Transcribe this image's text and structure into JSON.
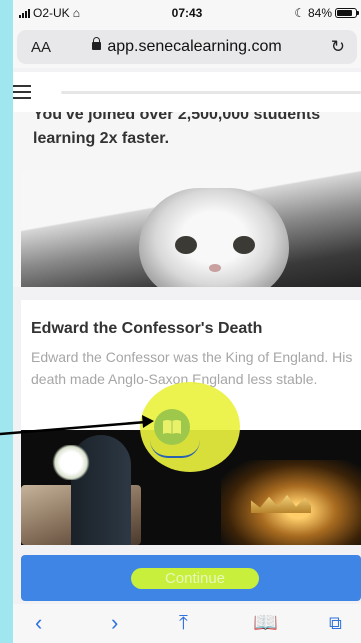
{
  "status_bar": {
    "carrier": "O2-UK",
    "time": "07:43",
    "battery_percent": "84%",
    "battery_level": 0.84,
    "signal_icon": "signal-bars-icon",
    "wifi_icon": "wifi-icon"
  },
  "browser": {
    "text_size_label": "AA",
    "url": "app.senecalearning.com",
    "lock_icon": "lock-icon",
    "reload_icon": "reload-icon"
  },
  "header": {
    "menu_icon": "hamburger-menu-icon"
  },
  "card_intro": {
    "cut_text": "You've joined over 2,500,000 students",
    "line2": "learning 2x faster.",
    "image": "cat-photo"
  },
  "card_lesson": {
    "title": "Edward the Confessor's Death",
    "description": "Edward the Confessor was the King of England. His death made Anglo-Saxon England less stable.",
    "image": "funeral-coffin-crown-photo",
    "book_icon": "open-book-icon"
  },
  "footer": {
    "continue_label": "Continue"
  },
  "toolbar": {
    "back_icon": "back-chevron-icon",
    "forward_icon": "forward-chevron-icon",
    "share_icon": "share-icon",
    "bookmarks_icon": "bookmarks-icon",
    "tabs_icon": "tabs-icon"
  },
  "colors": {
    "background": "#9fe6ee",
    "accent": "#3f85e6",
    "continue_button": "#c8ef3c",
    "highlight": "#ecf23f"
  }
}
